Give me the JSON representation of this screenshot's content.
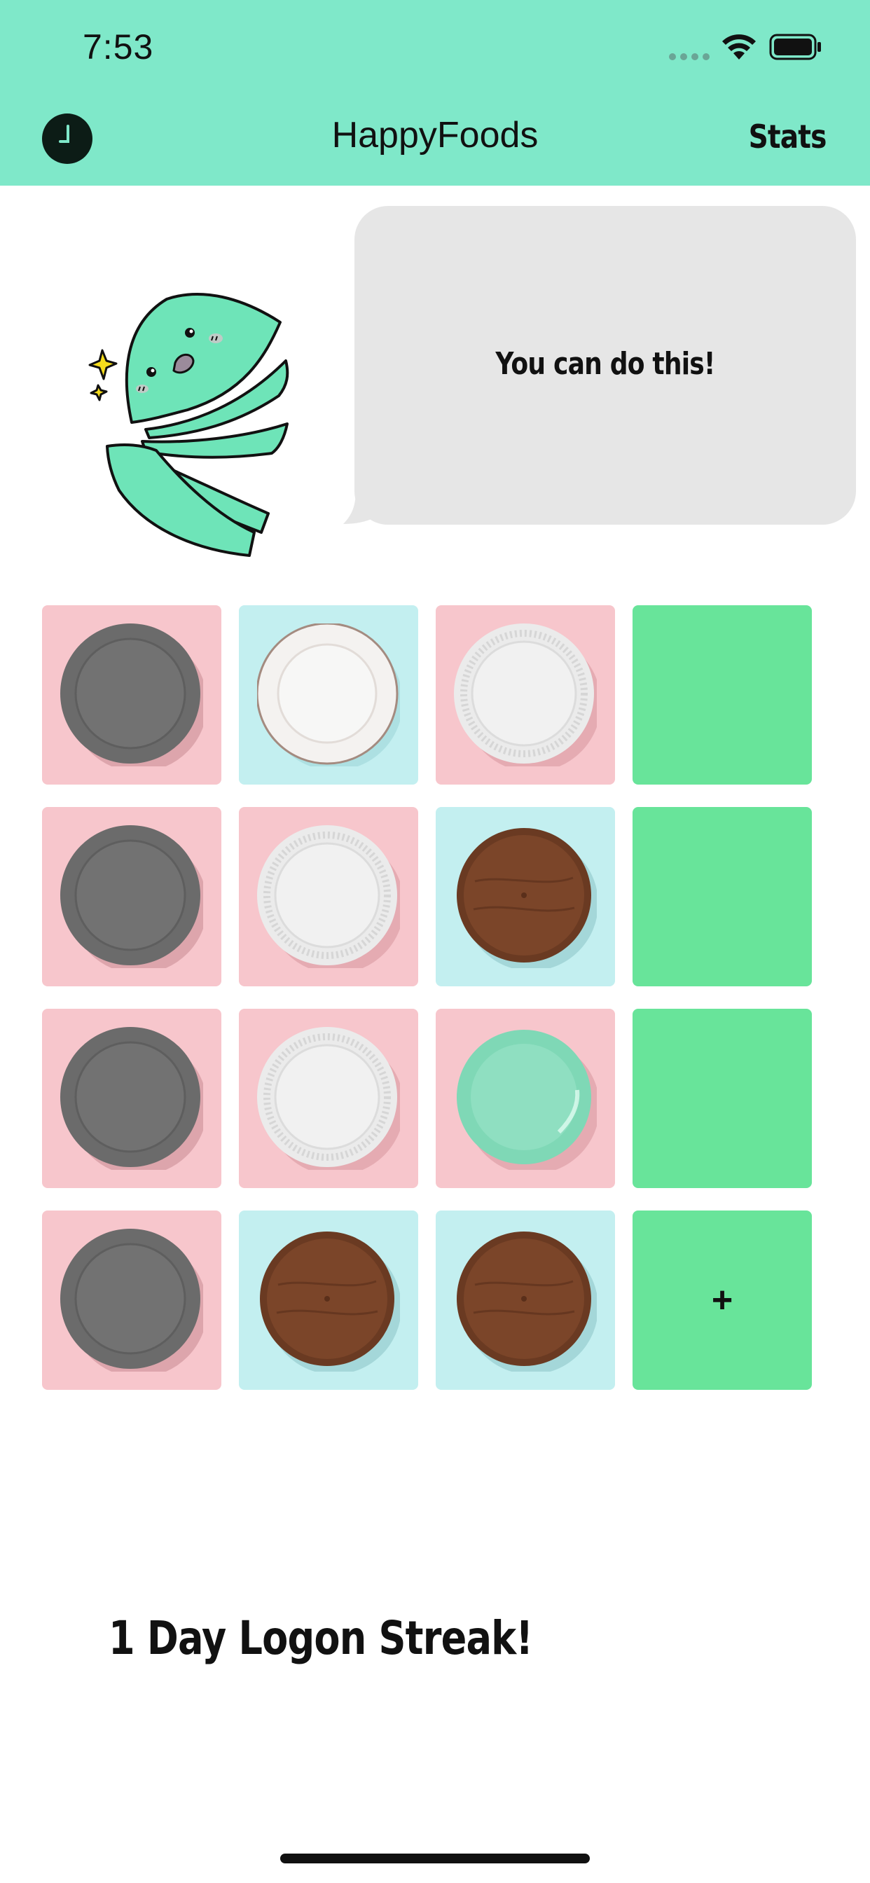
{
  "status_bar": {
    "time": "7:53"
  },
  "nav": {
    "title": "HappyFoods",
    "left_icon": "clock-icon",
    "stats_label": "Stats"
  },
  "mascot": {
    "bubble_text": "You can do this!"
  },
  "plate_grid": {
    "rows": [
      [
        {
          "background": "pink",
          "plate": "gray-plate"
        },
        {
          "background": "blue",
          "plate": "white-scalloped-plate"
        },
        {
          "background": "pink",
          "plate": "white-ribbed-plate"
        },
        {
          "background": "green",
          "plate": "empty"
        }
      ],
      [
        {
          "background": "pink",
          "plate": "gray-plate"
        },
        {
          "background": "pink",
          "plate": "white-ribbed-plate"
        },
        {
          "background": "blue",
          "plate": "wooden-plate"
        },
        {
          "background": "green",
          "plate": "empty"
        }
      ],
      [
        {
          "background": "pink",
          "plate": "gray-plate"
        },
        {
          "background": "pink",
          "plate": "white-ribbed-plate"
        },
        {
          "background": "pink",
          "plate": "mint-plate"
        },
        {
          "background": "green",
          "plate": "empty"
        }
      ],
      [
        {
          "background": "pink",
          "plate": "gray-plate"
        },
        {
          "background": "blue",
          "plate": "wooden-plate"
        },
        {
          "background": "blue",
          "plate": "wooden-plate"
        },
        {
          "background": "green",
          "plate": "add"
        }
      ]
    ],
    "add_label": "+"
  },
  "streak": {
    "text": "1 Day Logon Streak!"
  },
  "colors": {
    "header": "#7fe8c9",
    "tile_pink": "#f7c6cc",
    "tile_blue": "#c3eff0",
    "tile_green": "#68e49a",
    "bubble": "#e6e6e6",
    "mascot": "#6ee4b8"
  }
}
